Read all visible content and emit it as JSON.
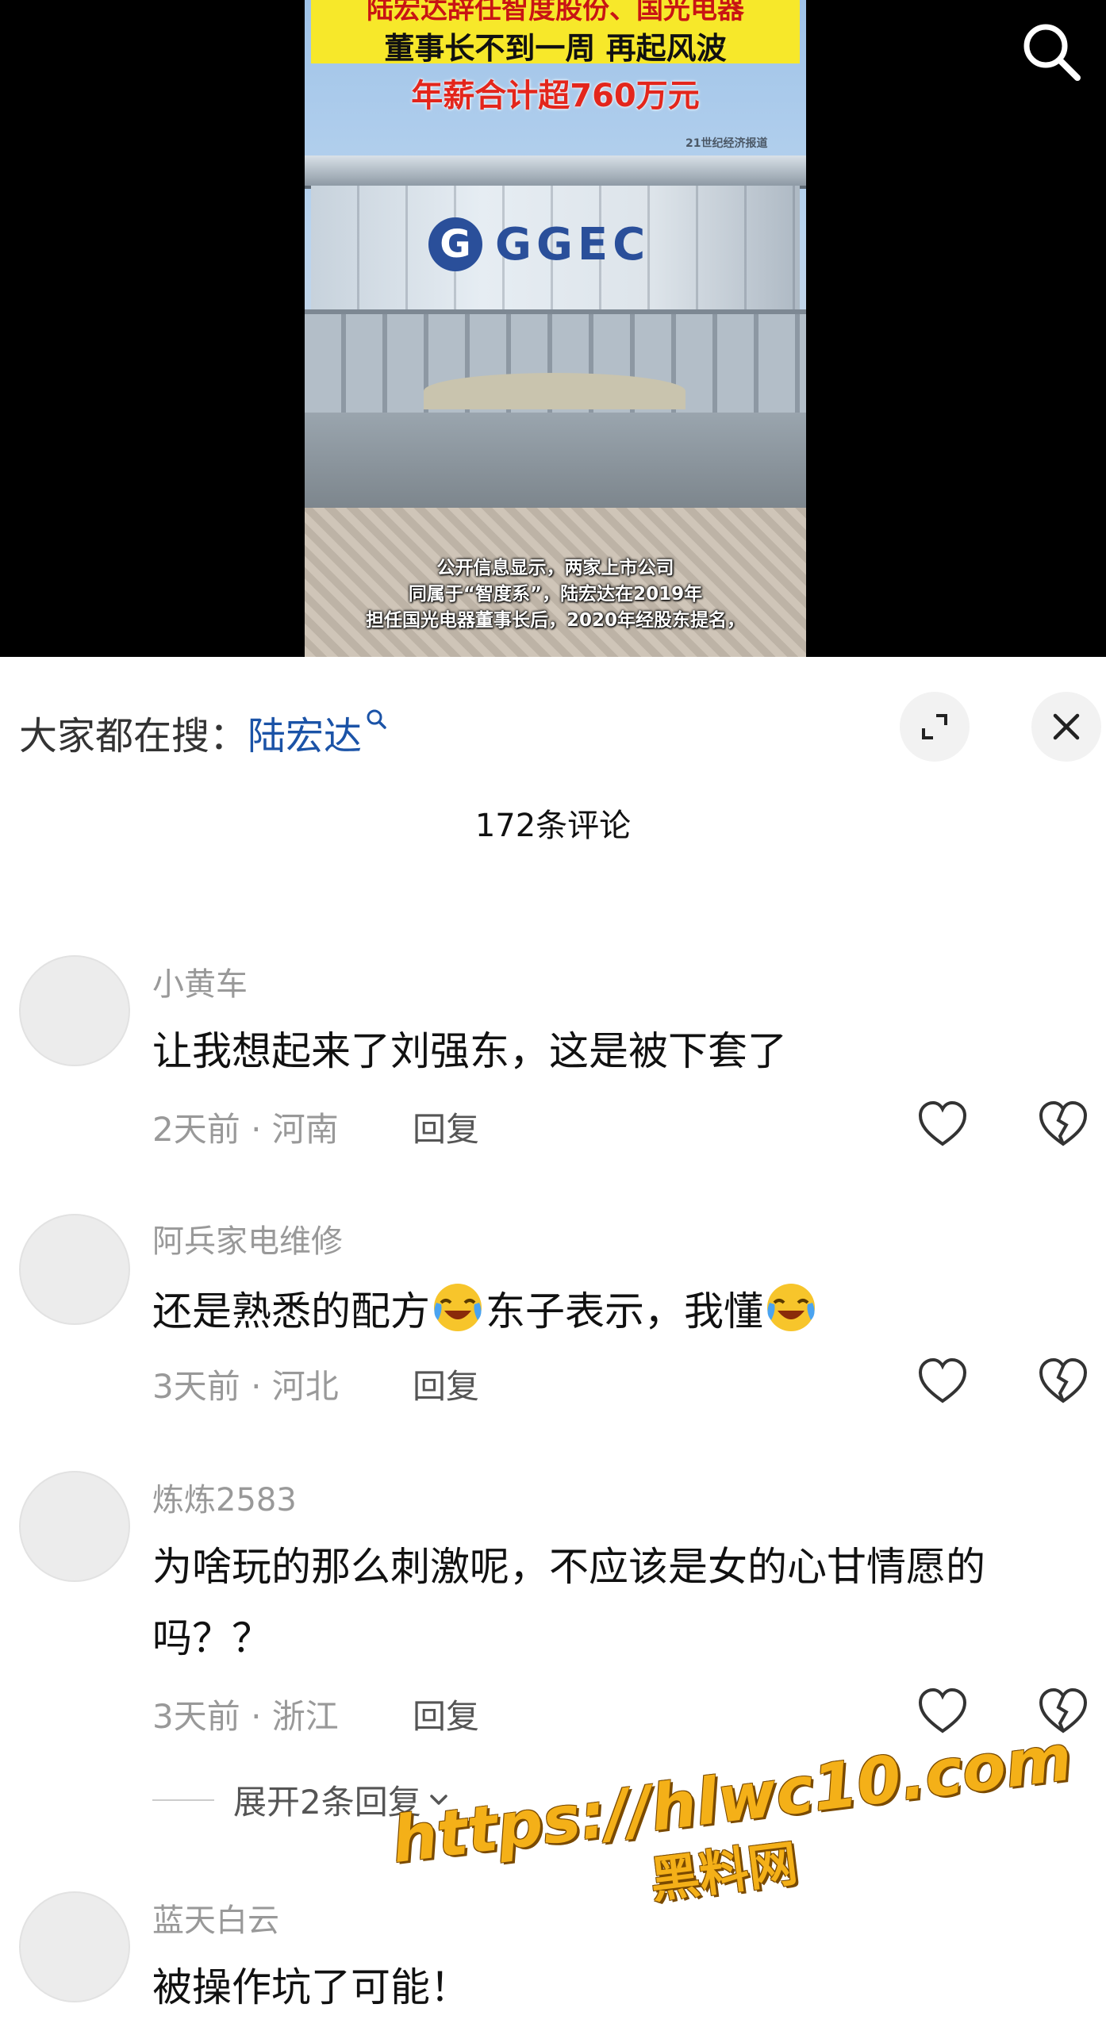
{
  "video": {
    "headline_line1": "陆宏达辞任智度股份、国光电器",
    "headline_line2": "董事长不到一周 再起风波",
    "headline_line3": "年薪合计超760万元",
    "source_tag": "21世纪经济报道",
    "brand_logo_text": "GGEC",
    "caption_lines": [
      "公开信息显示，两家上市公司",
      "同属于“智度系”，陆宏达在2019年",
      "担任国光电器董事长后，2020年经股东提名，"
    ]
  },
  "panel": {
    "trending_label": "大家都在搜：",
    "trending_term": "陆宏达",
    "comment_count": "172条评论"
  },
  "comments": [
    {
      "user": "小黄车",
      "text": "让我想起来了刘强东，这是被下套了",
      "meta": "2天前 · 河南",
      "reply": "回复"
    },
    {
      "user": "阿兵家电维修",
      "text_part1": "还是熟悉的配方",
      "text_part2": "东子表示，我懂",
      "meta": "3天前 · 河北",
      "reply": "回复"
    },
    {
      "user": "炼炼2583",
      "text": "为啥玩的那么刺激呢，不应该是女的心甘情愿的吗？？",
      "meta": "3天前 · 浙江",
      "reply": "回复"
    },
    {
      "user": "蓝天白云",
      "text": "被操作坑了可能！"
    }
  ],
  "expand_replies_label": "展开2条回复",
  "watermark": {
    "url": "https://hlwc10.com",
    "name": "黑料网"
  },
  "colors": {
    "accent_link": "#1b53a7",
    "muted_text": "#999999",
    "headline_red": "#e3261c",
    "banner_yellow": "#f7e82a",
    "watermark_gold": "#f4b018"
  },
  "icons": [
    "search-icon",
    "expand-icon",
    "close-icon",
    "heart-icon",
    "broken-heart-icon",
    "chevron-down-icon",
    "crying-laughing-emoji"
  ]
}
